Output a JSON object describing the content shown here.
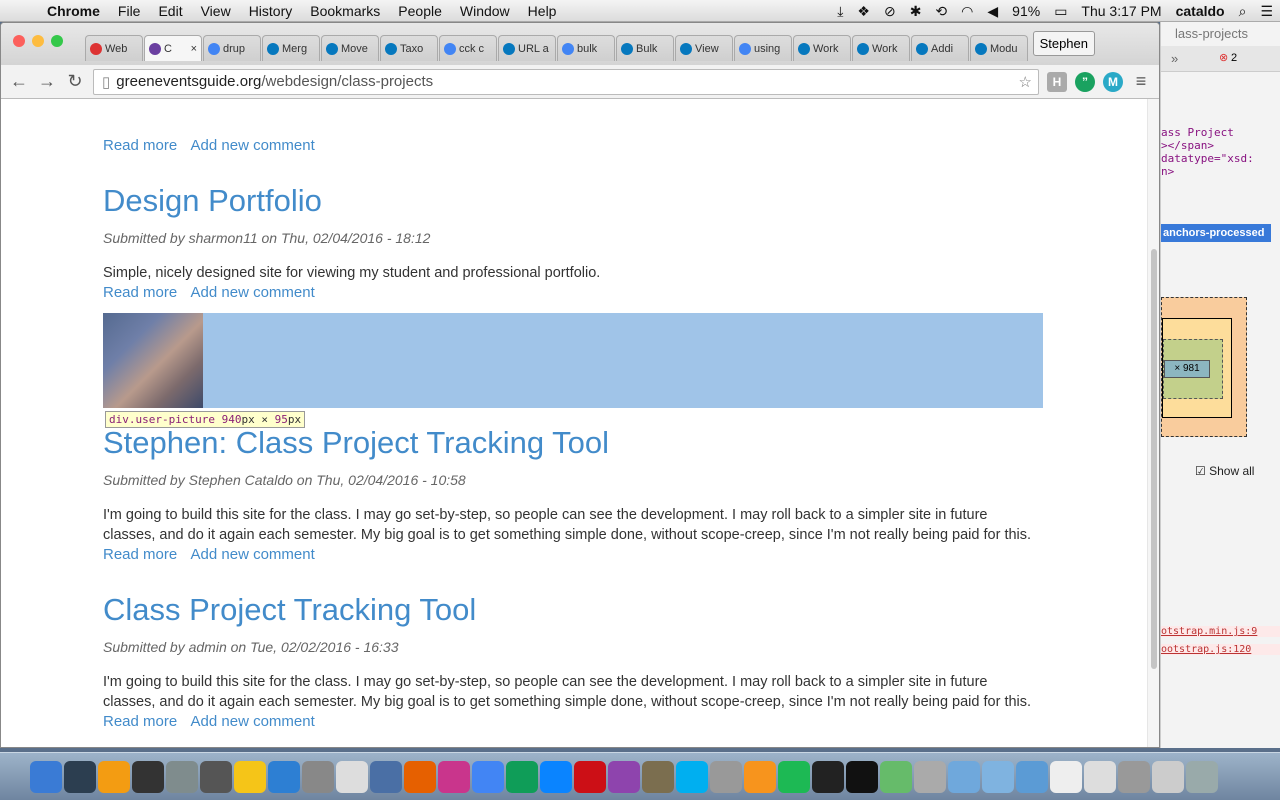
{
  "menubar": {
    "app": "Chrome",
    "items": [
      "File",
      "Edit",
      "View",
      "History",
      "Bookmarks",
      "People",
      "Window",
      "Help"
    ],
    "battery": "91%",
    "clock": "Thu 3:17 PM",
    "user": "cataldo"
  },
  "browser": {
    "tabs": [
      {
        "label": "Web",
        "icon": "gmail-icon",
        "color": "#d33"
      },
      {
        "label": "C",
        "icon": "drupal-icon",
        "color": "#6a3fa0"
      },
      {
        "label": "drup",
        "icon": "google-icon",
        "color": "#4285f4"
      },
      {
        "label": "Merg",
        "icon": "drupal-icon",
        "color": "#0678be"
      },
      {
        "label": "Move",
        "icon": "drupal-icon",
        "color": "#0678be"
      },
      {
        "label": "Taxo",
        "icon": "drupal-icon",
        "color": "#0678be"
      },
      {
        "label": "cck c",
        "icon": "google-icon",
        "color": "#4285f4"
      },
      {
        "label": "URL a",
        "icon": "drupal-icon",
        "color": "#0678be"
      },
      {
        "label": "bulk",
        "icon": "google-icon",
        "color": "#4285f4"
      },
      {
        "label": "Bulk",
        "icon": "drupal-icon",
        "color": "#0678be"
      },
      {
        "label": "View",
        "icon": "drupal-icon",
        "color": "#0678be"
      },
      {
        "label": "using",
        "icon": "google-icon",
        "color": "#4285f4"
      },
      {
        "label": "Work",
        "icon": "drupal-icon",
        "color": "#0678be"
      },
      {
        "label": "Work",
        "icon": "drupal-icon",
        "color": "#0678be"
      },
      {
        "label": "Addi",
        "icon": "drupal-icon",
        "color": "#0678be"
      },
      {
        "label": "Modu",
        "icon": "drupal-icon",
        "color": "#0678be"
      }
    ],
    "profile": "Stephen",
    "url_host": "greeneventsguide.org",
    "url_path": "/webdesign/class-projects"
  },
  "page": {
    "top_links": {
      "read_more": "Read more",
      "add_comment": "Add new comment"
    },
    "posts": [
      {
        "title": "Design Portfolio",
        "meta": "Submitted by sharmon11 on Thu, 02/04/2016 - 18:12",
        "body": "Simple, nicely designed site for viewing my student and professional portfolio.",
        "read_more": "Read more",
        "add_comment": "Add new comment"
      },
      {
        "title": "Stephen: Class Project Tracking Tool",
        "meta": "Submitted by Stephen Cataldo on Thu, 02/04/2016 - 10:58",
        "body": "I'm going to build this site for the class. I may go set-by-step, so people can see the development. I may roll back to a simpler site in future classes, and do it again each semester. My big goal is to get something simple done, without scope-creep, since I'm not really being paid for this.",
        "read_more": "Read more",
        "add_comment": "Add new comment"
      },
      {
        "title": "Class Project Tracking Tool",
        "meta": "Submitted by admin on Tue, 02/02/2016 - 16:33",
        "body": "I'm going to build this site for the class. I may go set-by-step, so people can see the development. I may roll back to a simpler site in future classes, and do it again each semester. My big goal is to get something simple done, without scope-creep, since I'm not really being paid for this.",
        "read_more": "Read more",
        "add_comment": "Add new comment"
      }
    ],
    "inspect_tooltip": {
      "selector": "div.user-picture",
      "w": "940",
      "h": "95"
    }
  },
  "devtools": {
    "title": "lass-projects",
    "error_count": "2",
    "code_lines": [
      "ass Project",
      "></span>",
      "datatype=\"xsd:",
      "n>"
    ],
    "selected": "anchors-processed",
    "content_size": "× 981",
    "show_all": "Show all",
    "links": [
      "otstrap.min.js:9",
      "ootstrap.js:120"
    ]
  },
  "dock": {
    "items": [
      "finder-icon",
      "activity-monitor-icon",
      "photo-icon",
      "console-icon",
      "preferences-icon",
      "calculator-icon",
      "wunderlist-icon",
      "app-store-icon",
      "server-icon",
      "notes-icon",
      "disk-icon",
      "firefox-icon",
      "itunes-icon",
      "chrome-icon",
      "drive-icon",
      "thunderbird-icon",
      "opera-icon",
      "paint-icon",
      "gimp-icon",
      "skype-icon",
      "help-icon",
      "ibooks-icon",
      "spotify-icon",
      "kindle-icon",
      "terminal-icon",
      "atom-icon",
      "disk-util-icon",
      "folder-icon",
      "downloads-icon",
      "applications-icon",
      "document-icon",
      "file-icon",
      "help-icon",
      "preview-icon",
      "trash-icon"
    ]
  }
}
